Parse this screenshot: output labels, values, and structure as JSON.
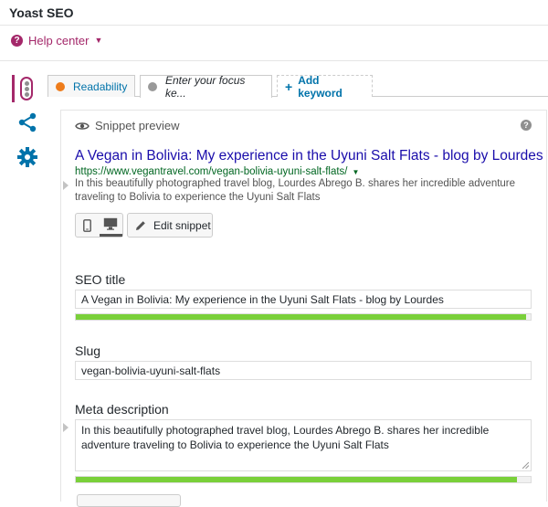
{
  "header": {
    "title": "Yoast SEO"
  },
  "help": {
    "label": "Help center"
  },
  "tabs": [
    {
      "label": "Readability",
      "status_color": "#ee7c1b"
    },
    {
      "label": "Enter your focus ke...",
      "status_color": "#999999"
    },
    {
      "label": "Add keyword"
    }
  ],
  "snippet": {
    "heading": "Snippet preview",
    "title": "A Vegan in Bolivia: My experience in the Uyuni Salt Flats - blog by Lourdes",
    "url": "https://www.vegantravel.com/vegan-bolivia-uyuni-salt-flats/",
    "description": "In this beautifully photographed travel blog, Lourdes Abrego B. shares her incredible adventure traveling to Bolivia to experience the Uyuni Salt Flats",
    "edit_label": "Edit snippet",
    "active_device": "desktop"
  },
  "fields": {
    "seo_title": {
      "label": "SEO title",
      "value": "A Vegan in Bolivia: My experience in the Uyuni Salt Flats - blog by Lourdes",
      "progress": 0.99
    },
    "slug": {
      "label": "Slug",
      "value": "vegan-bolivia-uyuni-salt-flats"
    },
    "meta_description": {
      "label": "Meta description",
      "value": "In this beautifully photographed travel blog, Lourdes Abrego B. shares her incredible adventure traveling to Bolivia to experience the Uyuni Salt Flats",
      "progress": 0.97
    }
  },
  "colors": {
    "brand": "#a4286a",
    "link": "#1a0dab",
    "url": "#006621",
    "good": "#7ad03a"
  }
}
